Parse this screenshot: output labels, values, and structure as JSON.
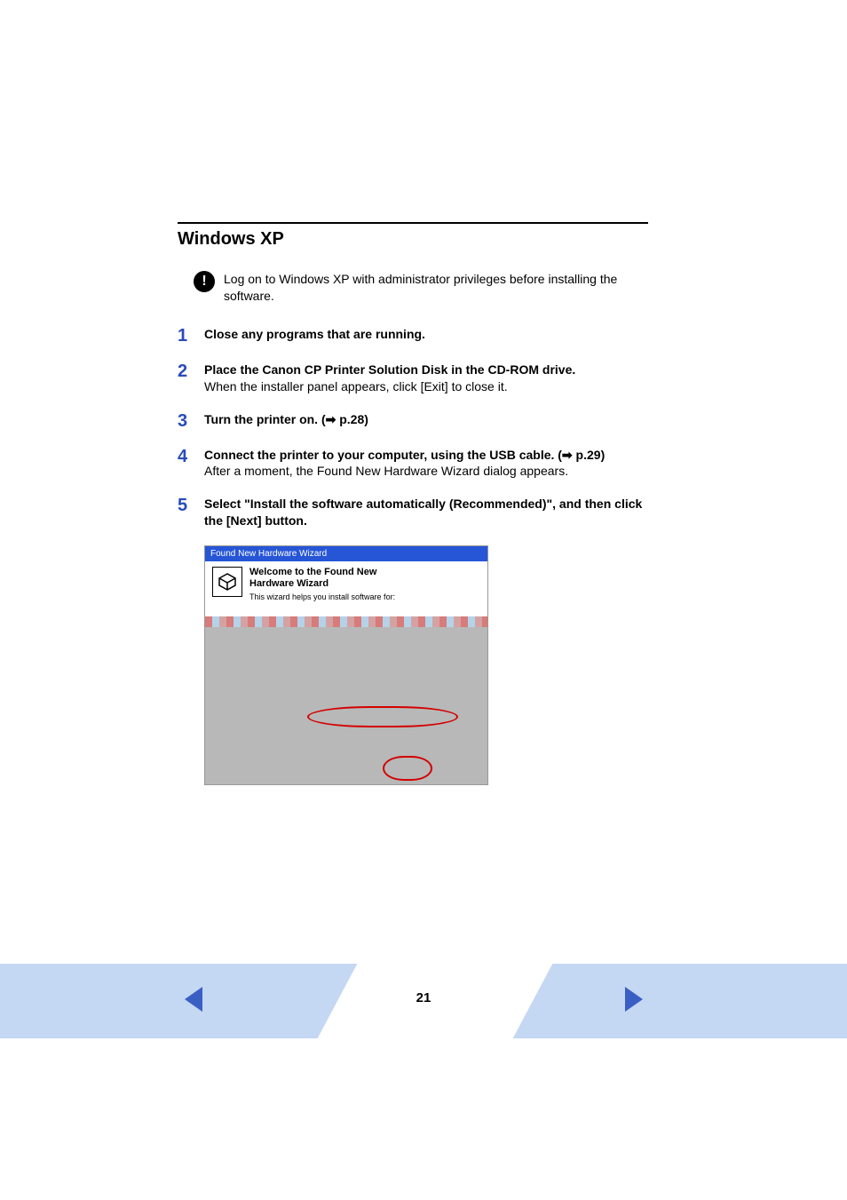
{
  "section_title": "Windows XP",
  "note": {
    "icon_glyph": "!",
    "text": "Log on to Windows XP with administrator privileges before installing the software."
  },
  "steps": [
    {
      "num": "1",
      "title": "Close any programs that are running."
    },
    {
      "num": "2",
      "title": "Place the Canon CP Printer Solution Disk in the CD-ROM drive.",
      "detail": "When the installer panel appears, click [Exit] to close it."
    },
    {
      "num": "3",
      "title": "Turn the printer on. (➡ p.28)"
    },
    {
      "num": "4",
      "title": "Connect the printer to your computer, using the USB cable. (➡ p.29)",
      "detail": "After a moment, the Found New Hardware Wizard dialog appears."
    },
    {
      "num": "5",
      "title": "Select \"Install the software automatically (Recommended)\", and then click the [Next] button."
    }
  ],
  "dialog": {
    "titlebar": "Found New Hardware Wizard",
    "wizard_title_line1": "Welcome to the Found New",
    "wizard_title_line2": "Hardware Wizard",
    "wizard_subtitle": "This wizard helps you install software for:"
  },
  "page_number": "21"
}
